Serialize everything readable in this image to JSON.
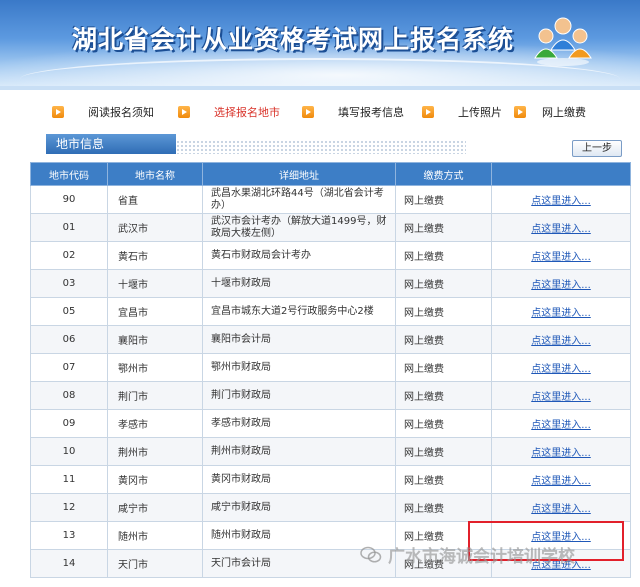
{
  "banner": {
    "title": "湖北省会计从业资格考试网上报名系统"
  },
  "steps": [
    {
      "label": "阅读报名须知",
      "active": false
    },
    {
      "label": "选择报名地市",
      "active": true
    },
    {
      "label": "填写报考信息",
      "active": false
    },
    {
      "label": "上传照片",
      "active": false
    },
    {
      "label": "网上缴费",
      "active": false
    }
  ],
  "section": {
    "title": "地市信息",
    "prev_label": "上一步"
  },
  "table": {
    "headers": [
      "地市代码",
      "地市名称",
      "详细地址",
      "缴费方式",
      ""
    ],
    "rows": [
      {
        "code": "90",
        "name": "省直",
        "address": "武昌水果湖北环路44号（湖北省会计考办）",
        "payment": "网上缴费",
        "action": "点这里进入..."
      },
      {
        "code": "01",
        "name": "武汉市",
        "address": "武汉市会计考办（解放大道1499号，财政局大楼左侧）",
        "payment": "网上缴费",
        "action": "点这里进入..."
      },
      {
        "code": "02",
        "name": "黄石市",
        "address": "黄石市财政局会计考办",
        "payment": "网上缴费",
        "action": "点这里进入..."
      },
      {
        "code": "03",
        "name": "十堰市",
        "address": "十堰市财政局",
        "payment": "网上缴费",
        "action": "点这里进入..."
      },
      {
        "code": "05",
        "name": "宜昌市",
        "address": "宜昌市城东大道2号行政服务中心2楼",
        "payment": "网上缴费",
        "action": "点这里进入..."
      },
      {
        "code": "06",
        "name": "襄阳市",
        "address": "襄阳市会计局",
        "payment": "网上缴费",
        "action": "点这里进入..."
      },
      {
        "code": "07",
        "name": "鄂州市",
        "address": "鄂州市财政局",
        "payment": "网上缴费",
        "action": "点这里进入..."
      },
      {
        "code": "08",
        "name": "荆门市",
        "address": "荆门市财政局",
        "payment": "网上缴费",
        "action": "点这里进入..."
      },
      {
        "code": "09",
        "name": "孝感市",
        "address": "孝感市财政局",
        "payment": "网上缴费",
        "action": "点这里进入..."
      },
      {
        "code": "10",
        "name": "荆州市",
        "address": "荆州市财政局",
        "payment": "网上缴费",
        "action": "点这里进入..."
      },
      {
        "code": "11",
        "name": "黄冈市",
        "address": "黄冈市财政局",
        "payment": "网上缴费",
        "action": "点这里进入..."
      },
      {
        "code": "12",
        "name": "咸宁市",
        "address": "咸宁市财政局",
        "payment": "网上缴费",
        "action": "点这里进入..."
      },
      {
        "code": "13",
        "name": "随州市",
        "address": "随州市财政局",
        "payment": "网上缴费",
        "action": "点这里进入..."
      },
      {
        "code": "14",
        "name": "天门市",
        "address": "天门市会计局",
        "payment": "网上缴费",
        "action": "点这里进入..."
      }
    ]
  },
  "watermark": {
    "text": "广水市海诚会计培训学校",
    "icon": "wechat-icon"
  },
  "colors": {
    "header_bg": "#3d7ec6",
    "step_active": "#d9332a",
    "link": "#1f58b8",
    "highlight": "#e2202b"
  }
}
